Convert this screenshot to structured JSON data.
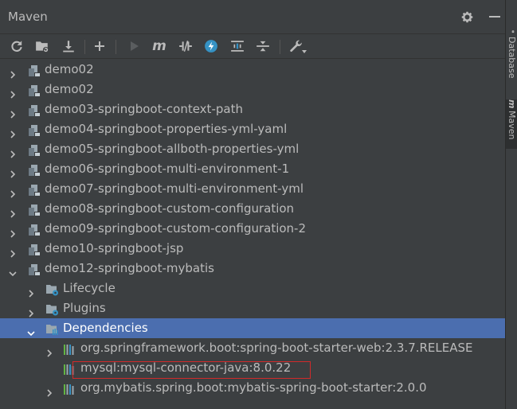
{
  "panel": {
    "title": "Maven"
  },
  "toolbar": {
    "icons": [
      "reload-icon",
      "add-folder-icon",
      "download-icon",
      "plus-icon",
      "run-icon",
      "execute-goal-icon",
      "toggle-offline-icon",
      "skip-tests-icon",
      "show-dependencies-icon",
      "collapse-all-icon",
      "wrench-icon"
    ],
    "execute_label": "m"
  },
  "tree": {
    "rows": [
      {
        "label": "demo02",
        "expanded": false,
        "level": 0,
        "icon": "maven-module-icon"
      },
      {
        "label": "demo02",
        "expanded": false,
        "level": 0,
        "icon": "maven-module-icon"
      },
      {
        "label": "demo03-springboot-context-path",
        "expanded": false,
        "level": 0,
        "icon": "maven-module-icon"
      },
      {
        "label": "demo04-springboot-properties-yml-yaml",
        "expanded": false,
        "level": 0,
        "icon": "maven-module-icon"
      },
      {
        "label": "demo05-springboot-allboth-properties-yml",
        "expanded": false,
        "level": 0,
        "icon": "maven-module-icon"
      },
      {
        "label": "demo06-springboot-multi-environment-1",
        "expanded": false,
        "level": 0,
        "icon": "maven-module-icon"
      },
      {
        "label": "demo07-springboot-multi-environment-yml",
        "expanded": false,
        "level": 0,
        "icon": "maven-module-icon"
      },
      {
        "label": "demo08-springboot-custom-configuration",
        "expanded": false,
        "level": 0,
        "icon": "maven-module-icon"
      },
      {
        "label": "demo09-springboot-custom-configuration-2",
        "expanded": false,
        "level": 0,
        "icon": "maven-module-icon"
      },
      {
        "label": "demo10-springboot-jsp",
        "expanded": false,
        "level": 0,
        "icon": "maven-module-icon"
      },
      {
        "label": "demo12-springboot-mybatis",
        "expanded": true,
        "level": 0,
        "icon": "maven-module-icon"
      },
      {
        "label": "Lifecycle",
        "expanded": false,
        "level": 1,
        "icon": "lifecycle-folder-icon"
      },
      {
        "label": "Plugins",
        "expanded": false,
        "level": 1,
        "icon": "plugins-folder-icon"
      },
      {
        "label": "Dependencies",
        "expanded": true,
        "level": 1,
        "icon": "dependencies-folder-icon",
        "selected": true
      },
      {
        "label": "org.springframework.boot:spring-boot-starter-web:2.3.7.RELEASE",
        "expanded": false,
        "level": 2,
        "icon": "library-icon"
      },
      {
        "label": "mysql:mysql-connector-java:8.0.22",
        "leaf": true,
        "level": 2,
        "icon": "library-icon",
        "highlighted": true
      },
      {
        "label": "org.mybatis.spring.boot:mybatis-spring-boot-starter:2.0.0",
        "expanded": false,
        "level": 2,
        "icon": "library-icon"
      }
    ]
  },
  "side_tabs": [
    {
      "label": "Database",
      "active": false
    },
    {
      "label": "Maven",
      "active": true
    }
  ],
  "colors": {
    "panel_bg": "#3c3f41",
    "selection_bg": "#4b6eaf",
    "highlight_border": "#d12a2a",
    "text": "#bbbbbb",
    "accent_blue": "#3592c4"
  }
}
